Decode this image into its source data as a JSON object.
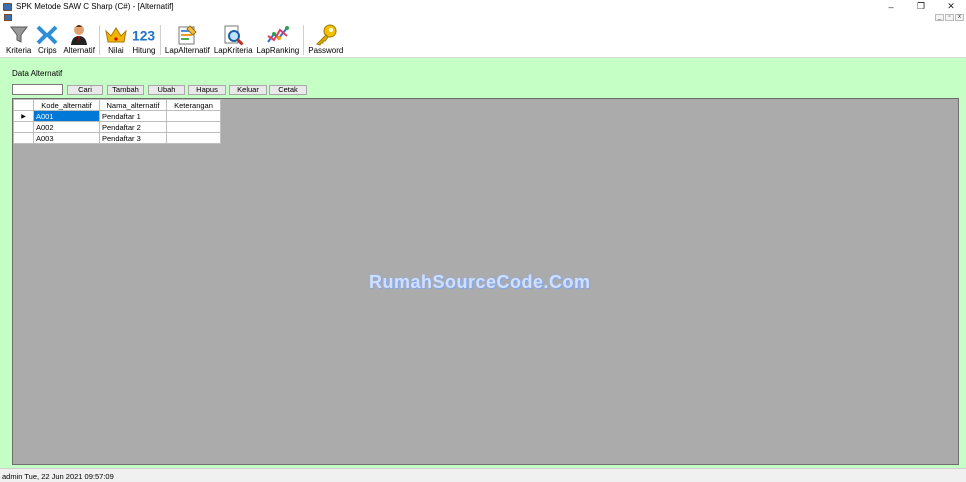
{
  "window": {
    "title": "SPK Metode SAW C Sharp (C#) - [Alternatif]",
    "controls": {
      "minimize": "–",
      "restore": "❐",
      "close": "✕"
    }
  },
  "mdi": {
    "controls": {
      "minimize": "_",
      "restore": "▫",
      "close": "x"
    }
  },
  "toolbar": {
    "items": [
      {
        "label": "Kriteria",
        "icon": "funnel-icon"
      },
      {
        "label": "Crips",
        "icon": "crips-icon"
      },
      {
        "label": "Alternatif",
        "icon": "person-icon"
      },
      {
        "label": "Nilai",
        "icon": "crown-icon"
      },
      {
        "label": "Hitung",
        "icon": "numbers-icon"
      },
      {
        "label": "LapAlternatif",
        "icon": "report-icon"
      },
      {
        "label": "LapKriteria",
        "icon": "magnifier-icon"
      },
      {
        "label": "LapRanking",
        "icon": "chart-icon"
      },
      {
        "label": "Password",
        "icon": "key-icon"
      }
    ],
    "number_glyph": "123"
  },
  "form": {
    "section_title": "Data Alternatif",
    "search_value": "",
    "buttons": {
      "cari": "Cari",
      "tambah": "Tambah",
      "ubah": "Ubah",
      "hapus": "Hapus",
      "keluar": "Keluar",
      "cetak": "Cetak"
    }
  },
  "grid": {
    "columns": [
      "Kode_alternatif",
      "Nama_alternatif",
      "Keterangan"
    ],
    "rows": [
      {
        "kode": "A001",
        "nama": "Pendaftar 1",
        "keterangan": ""
      },
      {
        "kode": "A002",
        "nama": "Pendaftar 2",
        "keterangan": ""
      },
      {
        "kode": "A003",
        "nama": "Pendaftar 3",
        "keterangan": ""
      }
    ],
    "current_row_marker": "▶"
  },
  "watermark": "RumahSourceCode.Com",
  "status": {
    "text": "admin Tue, 22 Jun 2021 09:57:09"
  },
  "colors": {
    "content_bg": "#c6ffc6",
    "grid_panel_bg": "#ababab",
    "selection": "#0078d7"
  }
}
